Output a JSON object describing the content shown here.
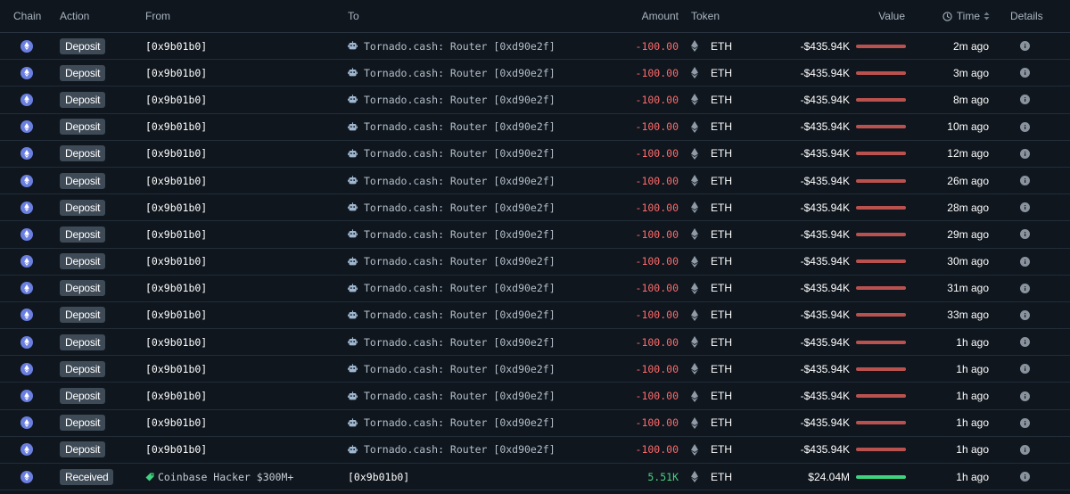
{
  "colors": {
    "background": "#0f161e",
    "negative": "#ff6b6b",
    "positive": "#4cd080",
    "bar_negative": "#b9524f",
    "bar_positive": "#3fd27f",
    "badge": "#3e4a56",
    "chain": "#6b7fe0"
  },
  "header": {
    "chain": "Chain",
    "action": "Action",
    "from": "From",
    "to": "To",
    "amount": "Amount",
    "token": "Token",
    "value": "Value",
    "time": "Time",
    "details": "Details"
  },
  "rows": [
    {
      "action": "Deposit",
      "from": "[0x9b01b0]",
      "to": "Tornado.cash: Router [0xd90e2f]",
      "amount": "-100.00",
      "token": "ETH",
      "value": "-$435.94K",
      "time": "2m ago",
      "direction": "out"
    },
    {
      "action": "Deposit",
      "from": "[0x9b01b0]",
      "to": "Tornado.cash: Router [0xd90e2f]",
      "amount": "-100.00",
      "token": "ETH",
      "value": "-$435.94K",
      "time": "3m ago",
      "direction": "out"
    },
    {
      "action": "Deposit",
      "from": "[0x9b01b0]",
      "to": "Tornado.cash: Router [0xd90e2f]",
      "amount": "-100.00",
      "token": "ETH",
      "value": "-$435.94K",
      "time": "8m ago",
      "direction": "out"
    },
    {
      "action": "Deposit",
      "from": "[0x9b01b0]",
      "to": "Tornado.cash: Router [0xd90e2f]",
      "amount": "-100.00",
      "token": "ETH",
      "value": "-$435.94K",
      "time": "10m ago",
      "direction": "out"
    },
    {
      "action": "Deposit",
      "from": "[0x9b01b0]",
      "to": "Tornado.cash: Router [0xd90e2f]",
      "amount": "-100.00",
      "token": "ETH",
      "value": "-$435.94K",
      "time": "12m ago",
      "direction": "out"
    },
    {
      "action": "Deposit",
      "from": "[0x9b01b0]",
      "to": "Tornado.cash: Router [0xd90e2f]",
      "amount": "-100.00",
      "token": "ETH",
      "value": "-$435.94K",
      "time": "26m ago",
      "direction": "out"
    },
    {
      "action": "Deposit",
      "from": "[0x9b01b0]",
      "to": "Tornado.cash: Router [0xd90e2f]",
      "amount": "-100.00",
      "token": "ETH",
      "value": "-$435.94K",
      "time": "28m ago",
      "direction": "out"
    },
    {
      "action": "Deposit",
      "from": "[0x9b01b0]",
      "to": "Tornado.cash: Router [0xd90e2f]",
      "amount": "-100.00",
      "token": "ETH",
      "value": "-$435.94K",
      "time": "29m ago",
      "direction": "out"
    },
    {
      "action": "Deposit",
      "from": "[0x9b01b0]",
      "to": "Tornado.cash: Router [0xd90e2f]",
      "amount": "-100.00",
      "token": "ETH",
      "value": "-$435.94K",
      "time": "30m ago",
      "direction": "out"
    },
    {
      "action": "Deposit",
      "from": "[0x9b01b0]",
      "to": "Tornado.cash: Router [0xd90e2f]",
      "amount": "-100.00",
      "token": "ETH",
      "value": "-$435.94K",
      "time": "31m ago",
      "direction": "out"
    },
    {
      "action": "Deposit",
      "from": "[0x9b01b0]",
      "to": "Tornado.cash: Router [0xd90e2f]",
      "amount": "-100.00",
      "token": "ETH",
      "value": "-$435.94K",
      "time": "33m ago",
      "direction": "out"
    },
    {
      "action": "Deposit",
      "from": "[0x9b01b0]",
      "to": "Tornado.cash: Router [0xd90e2f]",
      "amount": "-100.00",
      "token": "ETH",
      "value": "-$435.94K",
      "time": "1h ago",
      "direction": "out"
    },
    {
      "action": "Deposit",
      "from": "[0x9b01b0]",
      "to": "Tornado.cash: Router [0xd90e2f]",
      "amount": "-100.00",
      "token": "ETH",
      "value": "-$435.94K",
      "time": "1h ago",
      "direction": "out"
    },
    {
      "action": "Deposit",
      "from": "[0x9b01b0]",
      "to": "Tornado.cash: Router [0xd90e2f]",
      "amount": "-100.00",
      "token": "ETH",
      "value": "-$435.94K",
      "time": "1h ago",
      "direction": "out"
    },
    {
      "action": "Deposit",
      "from": "[0x9b01b0]",
      "to": "Tornado.cash: Router [0xd90e2f]",
      "amount": "-100.00",
      "token": "ETH",
      "value": "-$435.94K",
      "time": "1h ago",
      "direction": "out"
    },
    {
      "action": "Deposit",
      "from": "[0x9b01b0]",
      "to": "Tornado.cash: Router [0xd90e2f]",
      "amount": "-100.00",
      "token": "ETH",
      "value": "-$435.94K",
      "time": "1h ago",
      "direction": "out"
    },
    {
      "action": "Received",
      "from": "Coinbase Hacker $300M+",
      "to": "[0x9b01b0]",
      "amount": "5.51K",
      "token": "ETH",
      "value": "$24.04M",
      "time": "1h ago",
      "direction": "in"
    }
  ]
}
